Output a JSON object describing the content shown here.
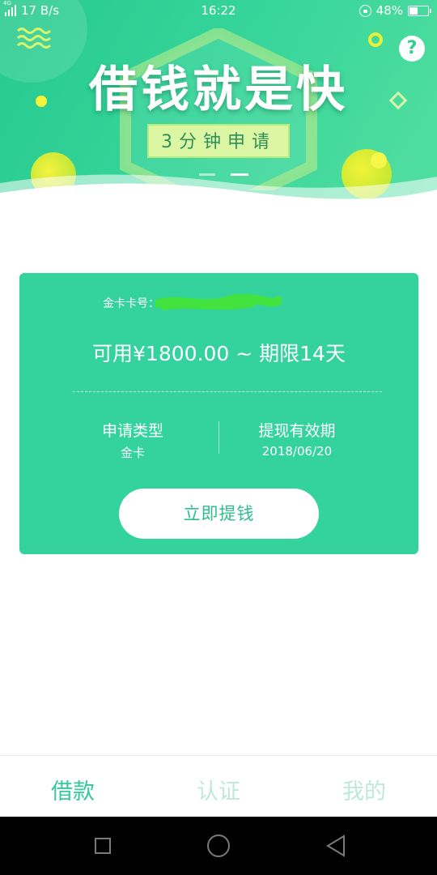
{
  "status_bar": {
    "network_tag": "4G",
    "speed": "17 B/s",
    "time": "16:22",
    "battery_percent": "48%",
    "battery_level": 0.48,
    "icons": [
      "signal-icon",
      "lock-rotation-icon",
      "battery-icon"
    ]
  },
  "banner": {
    "title": "借钱就是快",
    "subtitle": "3分钟申请",
    "help": "?",
    "colors": {
      "gradient_start": "#27c98e",
      "gradient_end": "#52dfa0",
      "subtitle_bg": "#dcf7a4",
      "accent_yellow": "#f4f23a"
    }
  },
  "card": {
    "card_no_label": "金卡卡号：",
    "amount_text": "可用¥1800.00 ~ 期限14天",
    "type_label": "申请类型",
    "type_value": "金卡",
    "validity_label": "提现有效期",
    "validity_value": "2018/06/20",
    "withdraw_button": "立即提钱",
    "colors": {
      "card_bg": "#34d29c",
      "button_text": "#2fbf8c"
    }
  },
  "tabs": {
    "borrow": "借款",
    "verify": "认证",
    "mine": "我的",
    "active": "borrow",
    "colors": {
      "active": "#34c99a",
      "inactive": "#bde9d8"
    }
  },
  "nav": {
    "icons": [
      "recent-apps-icon",
      "home-icon",
      "back-icon"
    ]
  }
}
